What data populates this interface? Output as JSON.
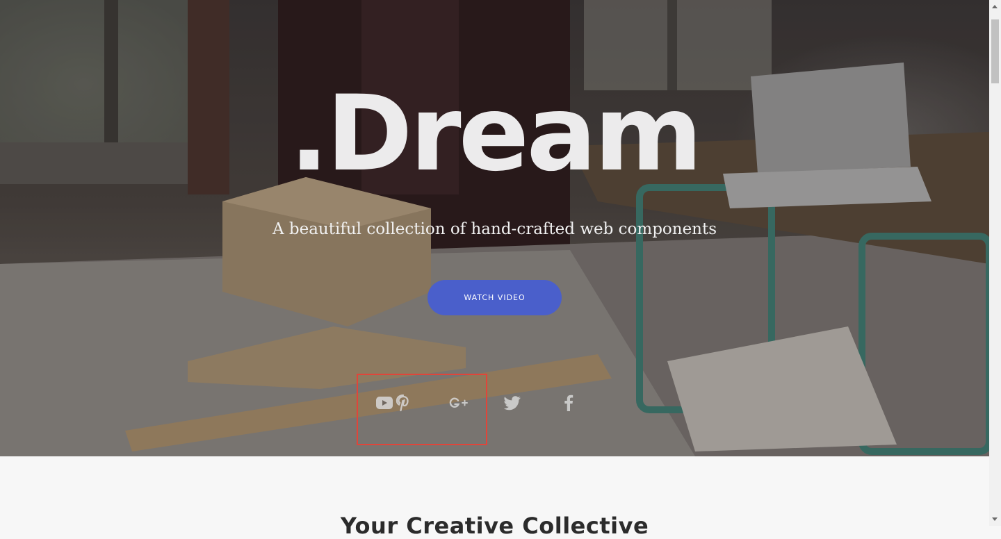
{
  "hero": {
    "title": ".Dream",
    "subtitle": "A beautiful collection of hand-crafted web components",
    "cta_label": "WATCH VIDEO"
  },
  "social": [
    {
      "icon": "youtube-icon"
    },
    {
      "icon": "pinterest-icon"
    },
    {
      "icon": "google-plus-icon"
    },
    {
      "icon": "twitter-icon"
    },
    {
      "icon": "facebook-icon"
    }
  ],
  "section": {
    "title": "Your Creative Collective"
  },
  "colors": {
    "accent": "#4a5fcb",
    "highlight": "#e0453a",
    "icon": "#d8d8d8"
  }
}
